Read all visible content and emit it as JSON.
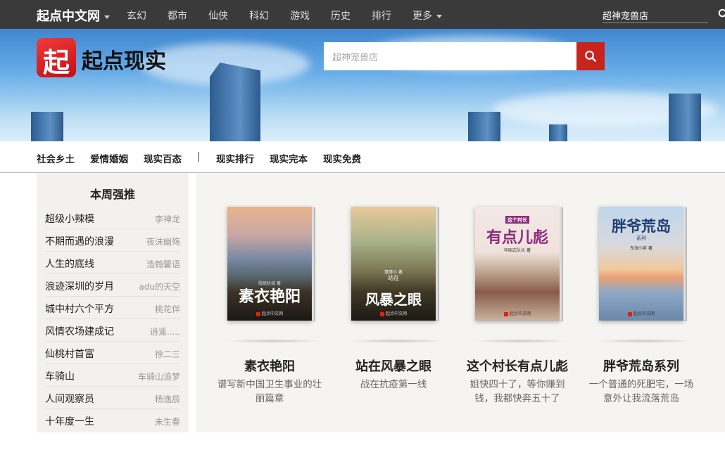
{
  "topnav": {
    "brand": "起点中文网",
    "items": [
      "玄幻",
      "都市",
      "仙侠",
      "科幻",
      "游戏",
      "历史",
      "排行",
      "更多"
    ],
    "search_value": "超神宠兽店"
  },
  "banner": {
    "logo_char": "起",
    "title": "起点现实",
    "search_placeholder": "超神宠兽店",
    "search_icon": "search-icon",
    "accent": "#c7241c"
  },
  "subnav": {
    "left": [
      "社会乡土",
      "爱情婚姻",
      "现实百态"
    ],
    "right": [
      "现实排行",
      "现实完本",
      "现实免费"
    ]
  },
  "weekly": {
    "title": "本周强推",
    "items": [
      {
        "title": "超级小辣模",
        "author": "李神龙"
      },
      {
        "title": "不期而遇的浪漫",
        "author": "夜沫幽殇"
      },
      {
        "title": "人生的底线",
        "author": "浩翰馨语"
      },
      {
        "title": "浪迹深圳的岁月",
        "author": "adu的天空"
      },
      {
        "title": "城中村六个平方",
        "author": "桃花伴"
      },
      {
        "title": "风情农场建成记",
        "author": "逍遥....."
      },
      {
        "title": "仙桃村首富",
        "author": "徐二三"
      },
      {
        "title": "车骑山",
        "author": "车骑山追梦"
      },
      {
        "title": "人间观察员",
        "author": "杨逸辰"
      },
      {
        "title": "十年度一生",
        "author": "未生春"
      }
    ]
  },
  "books": [
    {
      "title": "素衣艳阳",
      "desc": "谱写新中国卫生事业的壮丽篇章",
      "cover_title": "素衣艳阳",
      "cover_author": "肌眠机械 著",
      "cover_pub": "起点中文网"
    },
    {
      "title": "站在风暴之眼",
      "desc": "战在抗疫第一线",
      "cover_title": "风暴之眼",
      "cover_author": "瑾瑾小 著",
      "cover_small": "站在",
      "cover_pub": "起点中文网"
    },
    {
      "title": "这个村长有点儿彪",
      "desc": "姐快四十了，等你赚到钱，我都快奔五十了",
      "cover_top": "这个村长",
      "cover_title": "有点儿彪",
      "cover_author": "中国式队长 著",
      "cover_pub": "起点中文网"
    },
    {
      "title": "胖爷荒岛系列",
      "desc": "一个普通的死肥宅，一场意外让我流落荒岛",
      "cover_title": "胖爷荒岛",
      "cover_small": "系列",
      "cover_author": "东海小胖 著",
      "cover_pub": "起点中文网"
    }
  ]
}
